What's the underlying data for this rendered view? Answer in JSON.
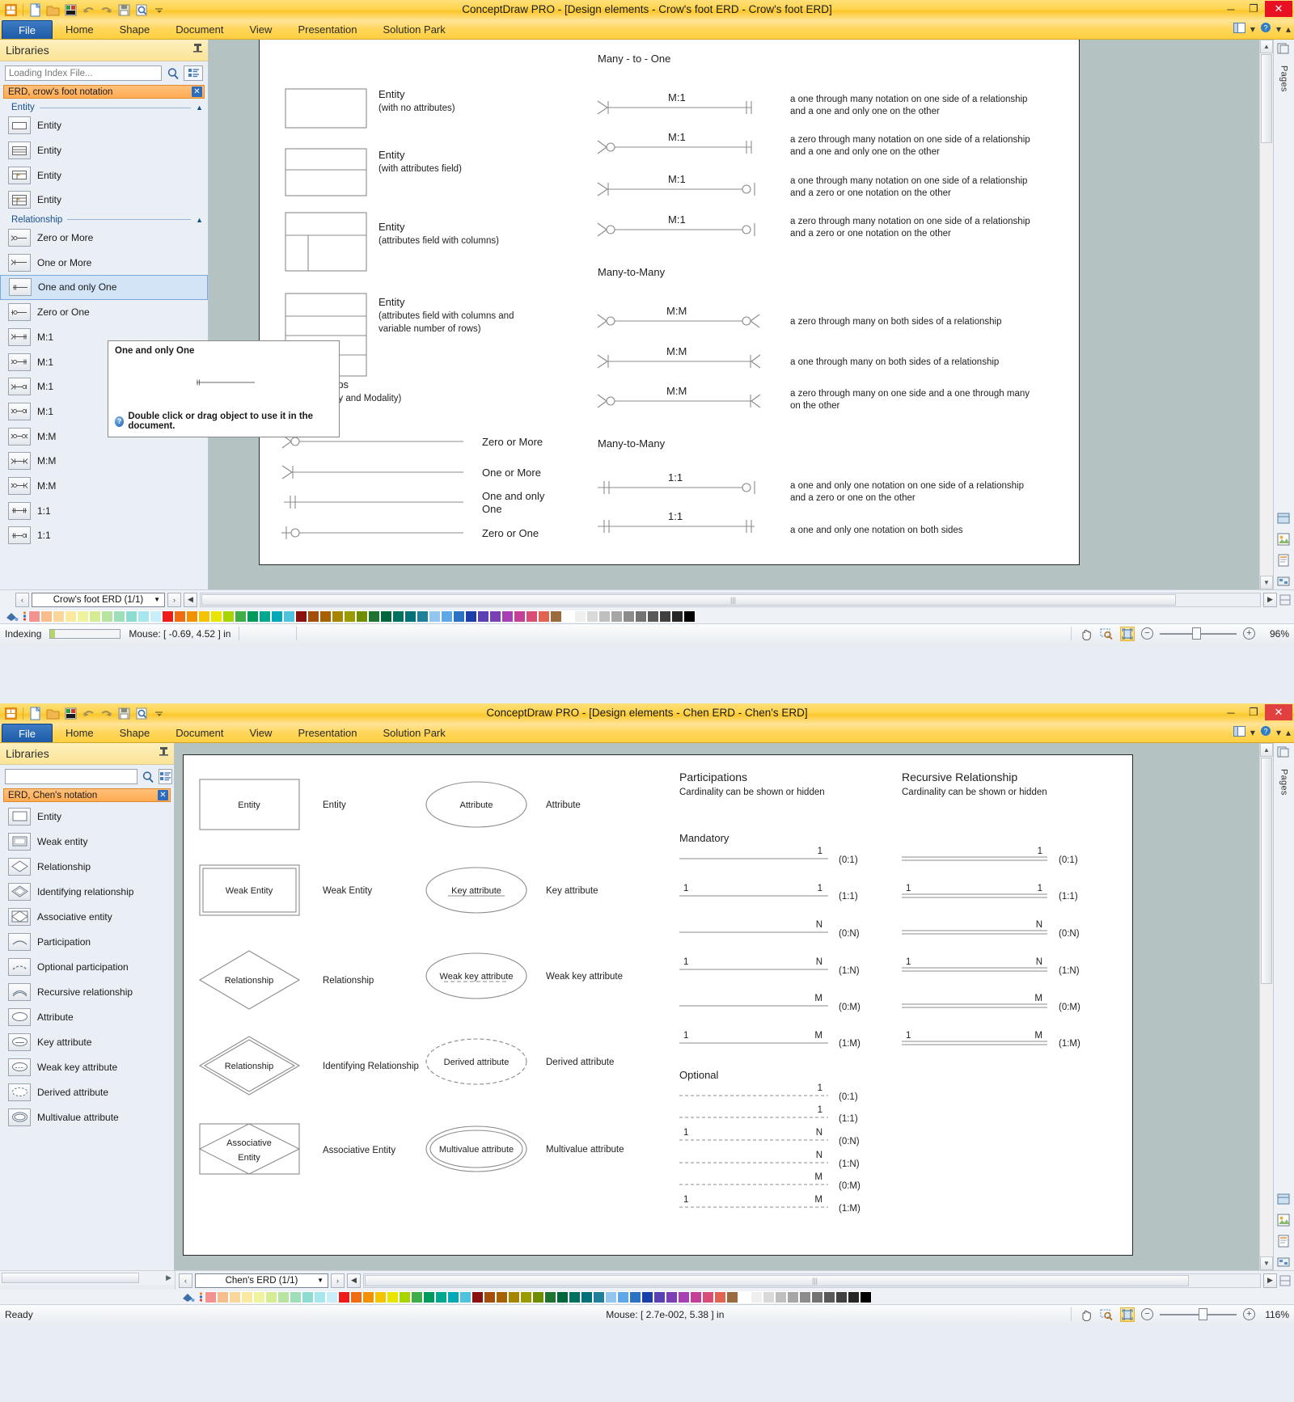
{
  "window1": {
    "title": "ConceptDraw PRO - [Design elements - Crow's foot ERD - Crow's foot ERD]",
    "quick_access_icons": [
      "app-logo-icon",
      "new-document-icon",
      "open-folder-icon",
      "new-from-template-icon",
      "undo-icon",
      "redo-icon",
      "save-icon",
      "print-preview-icon",
      "customize-qat-icon"
    ],
    "window_buttons": {
      "minimize": "─",
      "maximize": "❐",
      "close": "✕"
    },
    "ribbon_tabs": [
      {
        "label": "File",
        "active": true
      },
      {
        "label": "Home",
        "active": false
      },
      {
        "label": "Shape",
        "active": false
      },
      {
        "label": "Document",
        "active": false
      },
      {
        "label": "View",
        "active": false
      },
      {
        "label": "Presentation",
        "active": false
      },
      {
        "label": "Solution Park",
        "active": false
      }
    ],
    "ribbon_right_icons": [
      "window-layout-icon",
      "chevron-down-icon",
      "help-icon",
      "chevron-down-icon",
      "ribbon-collapse-icon"
    ],
    "sidebar": {
      "title": "Libraries",
      "pin_icon": "pin-icon",
      "search_value": "Loading Index File...",
      "search_placeholder": "Loading Index File...",
      "search_icon": "search-icon",
      "list_view_icon": "list-view-icon",
      "library_tab": {
        "label": "ERD, crow's foot notation",
        "close_icon": "close-icon"
      },
      "groups": [
        {
          "name": "Entity",
          "collapse_icon": "chevron-up-icon",
          "items": [
            {
              "label": "Entity",
              "icon": "entity-plain-icon",
              "selected": false
            },
            {
              "label": "Entity",
              "icon": "entity-rows-icon",
              "selected": false
            },
            {
              "label": "Entity",
              "icon": "entity-attrs-icon",
              "selected": false
            },
            {
              "label": "Entity",
              "icon": "entity-columns-icon",
              "selected": false
            }
          ]
        },
        {
          "name": "Relationship",
          "collapse_icon": "chevron-up-icon",
          "items": [
            {
              "label": "Zero or More",
              "icon": "zero-or-more-icon",
              "selected": false
            },
            {
              "label": "One or More",
              "icon": "one-or-more-icon",
              "selected": false
            },
            {
              "label": "One and only One",
              "icon": "one-and-only-one-icon",
              "selected": true
            },
            {
              "label": "Zero or One",
              "icon": "zero-or-one-icon",
              "selected": false
            },
            {
              "label": "M:1",
              "icon": "many-to-one-a-icon",
              "selected": false
            },
            {
              "label": "M:1",
              "icon": "many-to-one-b-icon",
              "selected": false
            },
            {
              "label": "M:1",
              "icon": "many-to-one-c-icon",
              "selected": false
            },
            {
              "label": "M:1",
              "icon": "many-to-one-d-icon",
              "selected": false
            },
            {
              "label": "M:M",
              "icon": "many-to-many-a-icon",
              "selected": false
            },
            {
              "label": "M:M",
              "icon": "many-to-many-b-icon",
              "selected": false
            },
            {
              "label": "M:M",
              "icon": "many-to-many-c-icon",
              "selected": false
            },
            {
              "label": "1:1",
              "icon": "one-to-one-a-icon",
              "selected": false
            },
            {
              "label": "1:1",
              "icon": "one-to-one-b-icon",
              "selected": false
            }
          ]
        }
      ],
      "tooltip": {
        "title": "One and only One",
        "footer": "Double click or drag object to use it in the document.",
        "help_icon": "help-circle-icon"
      }
    },
    "canvas": {
      "entities": [
        {
          "label": "Entity",
          "sub": "(with no attributes)"
        },
        {
          "label": "Entity",
          "sub": "(with attributes field)"
        },
        {
          "label": "Entity",
          "sub": "(attributes field with columns)"
        },
        {
          "label": "Entity",
          "sub": "(attributes field with columns and",
          "sub2": "variable number of rows)"
        }
      ],
      "relationships_heading": "Relationships",
      "relationships_sub": "(Cardinality and Modality)",
      "relationship_legend": [
        {
          "label": "Zero or More",
          "type": "zero-or-more"
        },
        {
          "label": "One or More",
          "type": "one-or-more"
        },
        {
          "label": "One and only",
          "label2": "One",
          "type": "one-and-only-one"
        },
        {
          "label": "Zero or One",
          "type": "zero-or-one"
        }
      ],
      "section_many_to_one": {
        "heading": "Many - to - One",
        "rows": [
          {
            "cardinality": "M:1",
            "left": "one-or-more",
            "right": "one-and-only-one",
            "desc": "a one through many notation on one side of a relationship",
            "desc2": "and a one and only one on the other"
          },
          {
            "cardinality": "M:1",
            "left": "zero-or-more",
            "right": "one-and-only-one",
            "desc": "a zero through many notation on one side of a relationship",
            "desc2": "and a one and only one on the other"
          },
          {
            "cardinality": "M:1",
            "left": "one-or-more",
            "right": "zero-or-one",
            "desc": "a one through many notation on one side of a relationship",
            "desc2": "and a zero or one notation on the other"
          },
          {
            "cardinality": "M:1",
            "left": "zero-or-more",
            "right": "zero-or-one",
            "desc": "a zero through many notation on one side of a relationship",
            "desc2": "and a zero or one notation on the other"
          }
        ]
      },
      "section_many_to_many": {
        "heading": "Many-to-Many",
        "rows": [
          {
            "cardinality": "M:M",
            "left": "zero-or-more",
            "right": "zero-or-more-r",
            "desc": "a zero through many on both sides of a relationship",
            "desc2": ""
          },
          {
            "cardinality": "M:M",
            "left": "one-or-more",
            "right": "one-or-more-r",
            "desc": "a one through many on both sides of a relationship",
            "desc2": ""
          },
          {
            "cardinality": "M:M",
            "left": "zero-or-more",
            "right": "one-or-more-r",
            "desc": "a zero through many on one side and a one through many",
            "desc2": "on the other"
          }
        ]
      },
      "section_one_to_one": {
        "heading": "Many-to-Many",
        "rows": [
          {
            "cardinality": "1:1",
            "left": "one-and-only-one",
            "right": "zero-or-one-r",
            "desc": "a one and only one notation on one side of a relationship",
            "desc2": "and a zero or one on the other"
          },
          {
            "cardinality": "1:1",
            "left": "one-and-only-one",
            "right": "one-and-only-one-r",
            "desc": "a one and only one notation on both sides",
            "desc2": ""
          }
        ]
      }
    },
    "rightdock": {
      "label": "Pages",
      "icons": [
        "pages-panel-icon",
        "library-panel-icon",
        "clipart-panel-icon",
        "hypernote-panel-icon",
        "rapid-draw-icon"
      ]
    },
    "tabbar": {
      "prev_icon": "chevron-left-icon",
      "next_icon": "chevron-right-icon",
      "page_name": "Crow's foot ERD (1/1)",
      "dropdown_icon": "chevron-down-icon",
      "scroll_left_icon": "triangle-left-icon",
      "scroll_right_icon": "triangle-right-icon",
      "resize_icon": "resize-grip-icon"
    },
    "palette": {
      "tool_icon": "fill-color-icon",
      "menu_icon": "palette-menu-icon",
      "colors": [
        "#f49292",
        "#f8bd8c",
        "#f9d79b",
        "#fbe9a0",
        "#eff39e",
        "#d6ec93",
        "#b7e4a0",
        "#9edfb9",
        "#8ddcd2",
        "#a6e6ef",
        "#c8eefa",
        "#ef1b1b",
        "#f06c13",
        "#f39200",
        "#f5c400",
        "#e9e500",
        "#a8d400",
        "#3fae49",
        "#009b5c",
        "#00a88f",
        "#00a9b5",
        "#4fc3dd",
        "#8b1111",
        "#a44e0c",
        "#a66200",
        "#a68600",
        "#9a9b00",
        "#6f8d00",
        "#1f7331",
        "#00673d",
        "#00705f",
        "#007179",
        "#1f8199",
        "#93c6ef",
        "#5fa8e8",
        "#2a72c4",
        "#1b3fa8",
        "#5b3fb5",
        "#7b3fb5",
        "#a73fb5",
        "#c43f96",
        "#d94e76",
        "#e0644f",
        "#9b6a3e",
        "#ffffff",
        "#efefef",
        "#d9d9d9",
        "#bfbfbf",
        "#a6a6a6",
        "#8c8c8c",
        "#737373",
        "#595959",
        "#404040",
        "#262626",
        "#000000"
      ]
    },
    "statusbar": {
      "indexing_label": "Indexing",
      "progress_percent": 7,
      "mouse": "Mouse: [ -0.69, 4.52 ] in",
      "hand_icon": "hand-tool-icon",
      "zoom_region_icon": "zoom-region-icon",
      "fit_page_icon": "fit-page-icon",
      "zoom_out_icon": "−",
      "zoom_in_icon": "+",
      "zoom_level": "96%"
    }
  },
  "window2": {
    "title": "ConceptDraw PRO - [Design elements - Chen ERD - Chen's ERD]",
    "quick_access_icons": [
      "app-logo-icon",
      "new-document-icon",
      "open-folder-icon",
      "new-from-template-icon",
      "undo-icon",
      "redo-icon",
      "save-icon",
      "print-preview-icon",
      "customize-qat-icon"
    ],
    "window_buttons": {
      "minimize": "─",
      "maximize": "❐",
      "close": "✕"
    },
    "ribbon_tabs": [
      {
        "label": "File",
        "active": true
      },
      {
        "label": "Home",
        "active": false
      },
      {
        "label": "Shape",
        "active": false
      },
      {
        "label": "Document",
        "active": false
      },
      {
        "label": "View",
        "active": false
      },
      {
        "label": "Presentation",
        "active": false
      },
      {
        "label": "Solution Park",
        "active": false
      }
    ],
    "sidebar": {
      "title": "Libraries",
      "pin_icon": "pin-icon",
      "search_value": "",
      "search_placeholder": "",
      "search_icon": "search-icon",
      "list_view_icon": "list-view-icon",
      "library_tab": {
        "label": "ERD, Chen's notation",
        "close_icon": "close-icon"
      },
      "items": [
        {
          "label": "Entity",
          "icon": "entity-icon"
        },
        {
          "label": "Weak entity",
          "icon": "weak-entity-icon"
        },
        {
          "label": "Relationship",
          "icon": "relationship-icon"
        },
        {
          "label": "Identifying relationship",
          "icon": "identifying-relationship-icon"
        },
        {
          "label": "Associative entity",
          "icon": "associative-entity-icon"
        },
        {
          "label": "Participation",
          "icon": "participation-icon"
        },
        {
          "label": "Optional participation",
          "icon": "optional-participation-icon"
        },
        {
          "label": "Recursive relationship",
          "icon": "recursive-relationship-icon"
        },
        {
          "label": "Attribute",
          "icon": "attribute-icon"
        },
        {
          "label": "Key attribute",
          "icon": "key-attribute-icon"
        },
        {
          "label": "Weak key attribute",
          "icon": "weak-key-attribute-icon"
        },
        {
          "label": "Derived attribute",
          "icon": "derived-attribute-icon"
        },
        {
          "label": "Multivalue attribute",
          "icon": "multivalue-attribute-icon"
        }
      ]
    },
    "canvas": {
      "column1": [
        {
          "shape": "rect",
          "shape_label": "Entity",
          "caption": "Entity"
        },
        {
          "shape": "double-rect",
          "shape_label": "Weak Entity",
          "caption": "Weak Entity"
        },
        {
          "shape": "diamond",
          "shape_label": "Relationship",
          "caption": "Relationship"
        },
        {
          "shape": "double-diamond",
          "shape_label": "Relationship",
          "caption": "Identifying Relationship"
        },
        {
          "shape": "rect-diamond",
          "shape_label": "Associative",
          "shape_label2": "Entity",
          "caption": "Associative Entity"
        }
      ],
      "column2": [
        {
          "shape": "ellipse",
          "shape_label": "Attribute",
          "caption": "Attribute"
        },
        {
          "shape": "ellipse-underline",
          "shape_label": "Key attribute",
          "caption": "Key attribute"
        },
        {
          "shape": "ellipse-dashed-underline",
          "shape_label": "Weak key attribute",
          "caption": "Weak key attribute"
        },
        {
          "shape": "ellipse-dashed",
          "shape_label": "Derived attribute",
          "caption": "Derived attribute"
        },
        {
          "shape": "double-ellipse",
          "shape_label": "Multivalue attribute",
          "caption": "Multivalue attribute"
        }
      ],
      "participations": {
        "heading": "Participations",
        "sub": "Cardinality can be shown or hidden",
        "mandatory_label": "Mandatory",
        "optional_label": "Optional",
        "mandatory_rows": [
          {
            "left": "",
            "right": "1",
            "note": "(0:1)"
          },
          {
            "left": "1",
            "right": "1",
            "note": "(1:1)"
          },
          {
            "left": "",
            "right": "N",
            "note": "(0:N)"
          },
          {
            "left": "1",
            "right": "N",
            "note": "(1:N)"
          },
          {
            "left": "",
            "right": "M",
            "note": "(0:M)"
          },
          {
            "left": "1",
            "right": "M",
            "note": "(1:M)"
          }
        ],
        "optional_rows": [
          {
            "left": "",
            "right": "1",
            "note": "(0:1)"
          },
          {
            "left": "",
            "right": "1",
            "note": "(1:1)"
          },
          {
            "left": "1",
            "right": "N",
            "note": "(0:N)"
          },
          {
            "left": "",
            "right": "N",
            "note": "(1:N)"
          },
          {
            "left": "",
            "right": "M",
            "note": "(0:M)"
          },
          {
            "left": "1",
            "right": "M",
            "note": "(1:M)"
          }
        ]
      },
      "recursive": {
        "heading": "Recursive Relationship",
        "sub": "Cardinality can be shown or hidden",
        "rows": [
          {
            "left": "",
            "right": "1",
            "note": "(0:1)"
          },
          {
            "left": "1",
            "right": "1",
            "note": "(1:1)"
          },
          {
            "left": "",
            "right": "N",
            "note": "(0:N)"
          },
          {
            "left": "1",
            "right": "N",
            "note": "(1:N)"
          },
          {
            "left": "",
            "right": "M",
            "note": "(0:M)"
          },
          {
            "left": "1",
            "right": "M",
            "note": "(1:M)"
          }
        ]
      }
    },
    "rightdock": {
      "label": "Pages",
      "icons": [
        "pages-panel-icon",
        "library-panel-icon",
        "clipart-panel-icon",
        "hypernote-panel-icon",
        "rapid-draw-icon"
      ]
    },
    "tabbar": {
      "prev_icon": "chevron-left-icon",
      "next_icon": "chevron-right-icon",
      "page_name": "Chen's ERD (1/1)",
      "dropdown_icon": "chevron-down-icon",
      "scroll_left_icon": "triangle-left-icon",
      "scroll_right_icon": "triangle-right-icon",
      "resize_icon": "resize-grip-icon"
    },
    "statusbar": {
      "ready_label": "Ready",
      "mouse": "Mouse: [ 2.7e-002, 5.38 ] in",
      "hand_icon": "hand-tool-icon",
      "zoom_region_icon": "zoom-region-icon",
      "fit_page_icon": "fit-page-icon",
      "zoom_out_icon": "−",
      "zoom_in_icon": "+",
      "zoom_level": "116%"
    }
  }
}
